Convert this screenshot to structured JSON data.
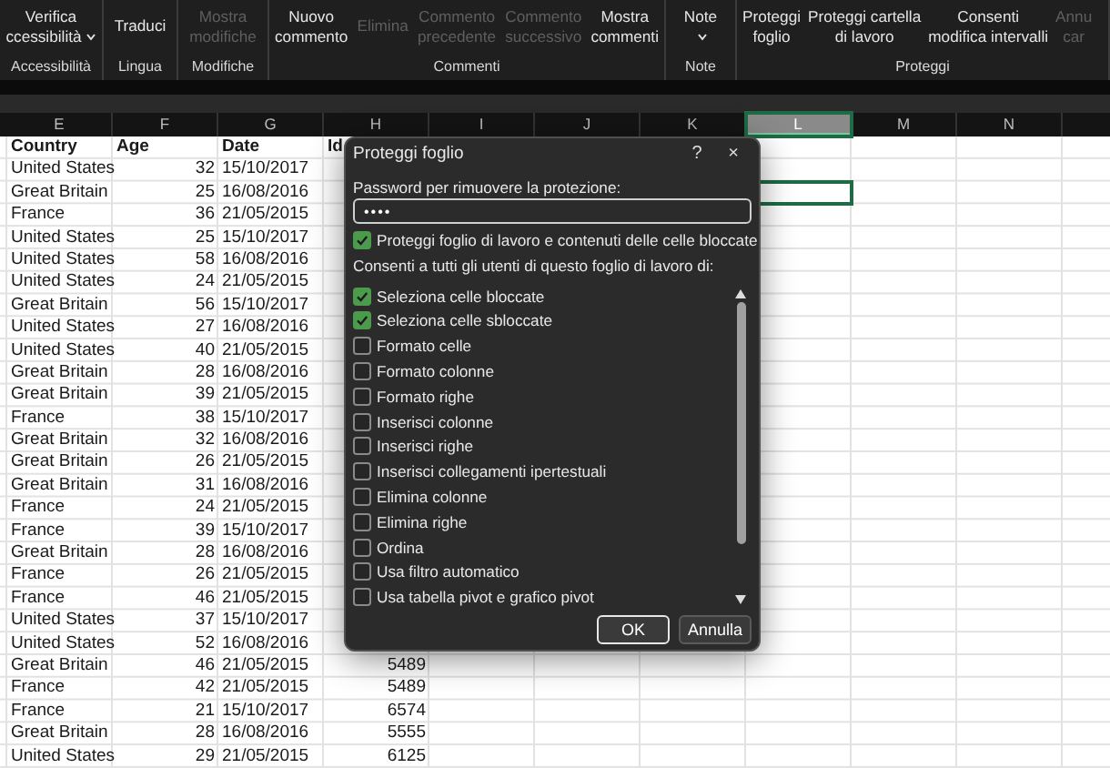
{
  "ribbon": {
    "groups": [
      {
        "label": "Accessibilità",
        "buttons": [
          {
            "lines": [
              "Verifica",
              "ccessibilità"
            ],
            "disabled": false,
            "dropdown": true
          }
        ]
      },
      {
        "label": "Lingua",
        "buttons": [
          {
            "lines": [
              "Traduci"
            ],
            "disabled": false,
            "dropdown": false
          }
        ]
      },
      {
        "label": "Modifiche",
        "buttons": [
          {
            "lines": [
              "Mostra",
              "modifiche"
            ],
            "disabled": true,
            "dropdown": false
          }
        ]
      },
      {
        "label": "Commenti",
        "buttons": [
          {
            "lines": [
              "Nuovo",
              "commento"
            ],
            "disabled": false,
            "dropdown": false
          },
          {
            "lines": [
              "Elimina"
            ],
            "disabled": true,
            "dropdown": false
          },
          {
            "lines": [
              "Commento",
              "precedente"
            ],
            "disabled": true,
            "dropdown": false
          },
          {
            "lines": [
              "Commento",
              "successivo"
            ],
            "disabled": true,
            "dropdown": false
          },
          {
            "lines": [
              "Mostra",
              "commenti"
            ],
            "disabled": false,
            "dropdown": false
          }
        ]
      },
      {
        "label": "Note",
        "buttons": [
          {
            "lines": [
              "Note"
            ],
            "disabled": false,
            "dropdown": true
          }
        ]
      },
      {
        "label": "Proteggi",
        "buttons": [
          {
            "lines": [
              "Proteggi",
              "foglio"
            ],
            "disabled": false,
            "dropdown": false
          },
          {
            "lines": [
              "Proteggi cartella",
              "di lavoro"
            ],
            "disabled": false,
            "dropdown": false
          },
          {
            "lines": [
              "Consenti",
              "modifica intervalli"
            ],
            "disabled": false,
            "dropdown": false
          },
          {
            "lines": [
              "Annu",
              "car"
            ],
            "disabled": true,
            "dropdown": false
          }
        ]
      }
    ]
  },
  "sheet": {
    "columns": [
      {
        "label": "E",
        "selected": false
      },
      {
        "label": "F",
        "selected": false
      },
      {
        "label": "G",
        "selected": false
      },
      {
        "label": "H",
        "selected": false
      },
      {
        "label": "I",
        "selected": false
      },
      {
        "label": "J",
        "selected": false
      },
      {
        "label": "K",
        "selected": false
      },
      {
        "label": "L",
        "selected": true
      },
      {
        "label": "M",
        "selected": false
      },
      {
        "label": "N",
        "selected": false
      }
    ],
    "header": [
      "Country",
      "Age",
      "Date",
      "Id"
    ],
    "rows": [
      {
        "country": "United States",
        "age": "32",
        "date": "15/10/2017",
        "selected": false
      },
      {
        "country": "Great Britain",
        "age": "25",
        "date": "16/08/2016",
        "selected": true
      },
      {
        "country": "France",
        "age": "36",
        "date": "21/05/2015",
        "selected": false
      },
      {
        "country": "United States",
        "age": "25",
        "date": "15/10/2017",
        "selected": false
      },
      {
        "country": "United States",
        "age": "58",
        "date": "16/08/2016",
        "selected": false
      },
      {
        "country": "United States",
        "age": "24",
        "date": "21/05/2015",
        "selected": false
      },
      {
        "country": "Great Britain",
        "age": "56",
        "date": "15/10/2017",
        "selected": false
      },
      {
        "country": "United States",
        "age": "27",
        "date": "16/08/2016",
        "selected": false
      },
      {
        "country": "United States",
        "age": "40",
        "date": "21/05/2015",
        "selected": false
      },
      {
        "country": "Great Britain",
        "age": "28",
        "date": "16/08/2016",
        "selected": false
      },
      {
        "country": "Great Britain",
        "age": "39",
        "date": "21/05/2015",
        "selected": false
      },
      {
        "country": "France",
        "age": "38",
        "date": "15/10/2017",
        "selected": false
      },
      {
        "country": "Great Britain",
        "age": "32",
        "date": "16/08/2016",
        "selected": false
      },
      {
        "country": "Great Britain",
        "age": "26",
        "date": "21/05/2015",
        "selected": false
      },
      {
        "country": "Great Britain",
        "age": "31",
        "date": "16/08/2016",
        "selected": false
      },
      {
        "country": "France",
        "age": "24",
        "date": "21/05/2015",
        "selected": false
      },
      {
        "country": "France",
        "age": "39",
        "date": "15/10/2017",
        "selected": false
      },
      {
        "country": "Great Britain",
        "age": "28",
        "date": "16/08/2016",
        "selected": false
      },
      {
        "country": "France",
        "age": "26",
        "date": "21/05/2015",
        "selected": false
      },
      {
        "country": "France",
        "age": "46",
        "date": "21/05/2015",
        "selected": false
      },
      {
        "country": "United States",
        "age": "37",
        "date": "15/10/2017",
        "selected": false
      },
      {
        "country": "United States",
        "age": "52",
        "date": "16/08/2016",
        "selected": false
      },
      {
        "country": "Great Britain",
        "age": "46",
        "date": "21/05/2015",
        "id": "5489",
        "selected": false
      },
      {
        "country": "France",
        "age": "42",
        "date": "21/05/2015",
        "id": "5489",
        "selected": false
      },
      {
        "country": "France",
        "age": "21",
        "date": "15/10/2017",
        "id": "6574",
        "selected": false
      },
      {
        "country": "Great Britain",
        "age": "28",
        "date": "16/08/2016",
        "id": "5555",
        "selected": false
      },
      {
        "country": "United States",
        "age": "29",
        "date": "21/05/2015",
        "id": "6125",
        "selected": false
      }
    ]
  },
  "dialog": {
    "title": "Proteggi foglio",
    "help": "?",
    "close": "×",
    "password_label": "Password per rimuovere la protezione:",
    "password_value": "••••",
    "protect": {
      "label": "Proteggi foglio di lavoro e contenuti delle celle bloccate",
      "checked": true
    },
    "allow_label": "Consenti a tutti gli utenti di questo foglio di lavoro di:",
    "options": [
      {
        "label": "Seleziona celle bloccate",
        "checked": true
      },
      {
        "label": "Seleziona celle sbloccate",
        "checked": true
      },
      {
        "label": "Formato celle",
        "checked": false
      },
      {
        "label": "Formato colonne",
        "checked": false
      },
      {
        "label": "Formato righe",
        "checked": false
      },
      {
        "label": "Inserisci colonne",
        "checked": false
      },
      {
        "label": "Inserisci righe",
        "checked": false
      },
      {
        "label": "Inserisci collegamenti ipertestuali",
        "checked": false
      },
      {
        "label": "Elimina colonne",
        "checked": false
      },
      {
        "label": "Elimina righe",
        "checked": false
      },
      {
        "label": "Ordina",
        "checked": false
      },
      {
        "label": "Usa filtro automatico",
        "checked": false
      },
      {
        "label": "Usa tabella pivot e grafico pivot",
        "checked": false
      }
    ],
    "buttons": [
      {
        "label": "OK",
        "default": true
      },
      {
        "label": "Annulla",
        "default": false
      }
    ]
  }
}
